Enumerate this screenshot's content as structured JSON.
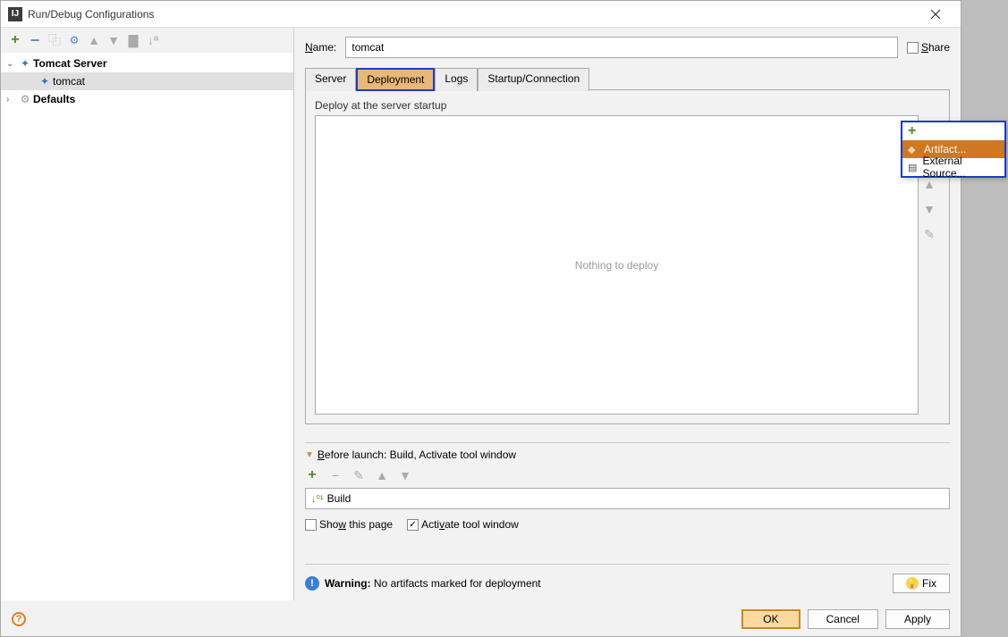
{
  "window": {
    "title": "Run/Debug Configurations"
  },
  "tree": {
    "tomcat_server": "Tomcat Server",
    "tomcat_child": "tomcat",
    "defaults": "Defaults"
  },
  "name": {
    "label_prefix": "N",
    "label_rest": "ame:",
    "value": "tomcat"
  },
  "share": {
    "label_prefix": "S",
    "label_rest": "hare"
  },
  "tabs": {
    "server": "Server",
    "deployment": "Deployment",
    "logs": "Logs",
    "startup": "Startup/Connection"
  },
  "deploy": {
    "label": "Deploy at the server startup",
    "empty_text": "Nothing to deploy"
  },
  "before_launch": {
    "label_prefix": "B",
    "label_rest": "efore launch: Build, Activate tool window",
    "build": "Build",
    "show_prefix": "w",
    "show_label": "Sho",
    "show_rest": " this page",
    "activate_prefix": "v",
    "activate_label": "Acti",
    "activate_rest": "ate tool window"
  },
  "warning": {
    "label": "Warning:",
    "text": "No artifacts marked for deployment",
    "fix": "Fix"
  },
  "footer": {
    "ok": "OK",
    "cancel": "Cancel",
    "apply": "Apply"
  },
  "popup": {
    "artifact": "Artifact...",
    "external": "External Source..."
  }
}
